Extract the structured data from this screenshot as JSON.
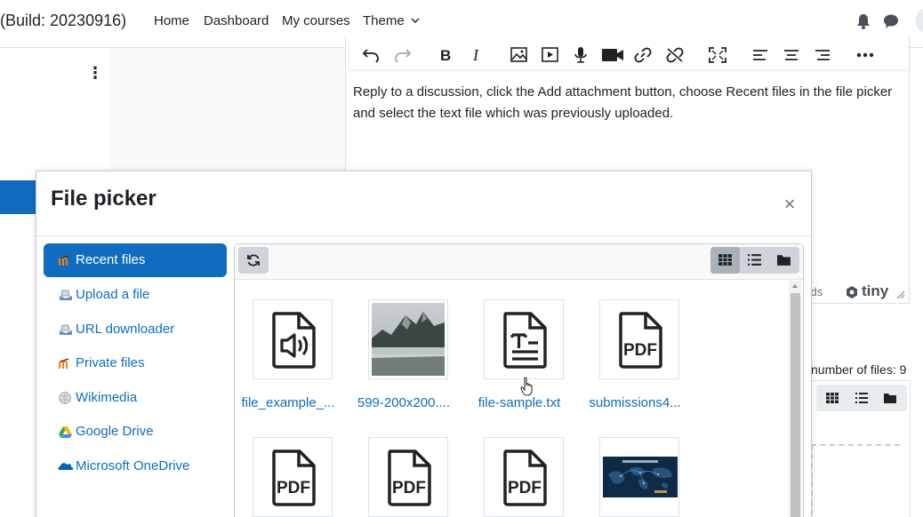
{
  "navbar": {
    "brand": "(Build: 20230916)",
    "links": [
      "Home",
      "Dashboard",
      "My courses",
      "Theme"
    ],
    "theme_dropdown_icon": "chevron-down-icon",
    "icons": [
      "bell-icon",
      "chat-icon"
    ]
  },
  "editor": {
    "toolbar_icons": [
      "undo-icon",
      "redo-icon",
      "bold-icon",
      "italic-icon",
      "image-icon",
      "media-icon",
      "record-audio-icon",
      "record-video-icon",
      "link-icon",
      "unlink-icon",
      "fullscreen-icon",
      "align-left-icon",
      "align-center-icon",
      "align-right-icon",
      "more-icon"
    ],
    "body_text": "Reply to a discussion, click the Add attachment button, choose Recent files in the file picker and select the text file which was previously uploaded.",
    "status_words": "ords",
    "status_brand": "tiny"
  },
  "filemanager": {
    "file_count_text": "number of files: 9"
  },
  "file_picker": {
    "title": "File picker",
    "close_symbol": "×",
    "repositories": [
      {
        "label": "Recent files",
        "icon": "moodle-icon",
        "active": true
      },
      {
        "label": "Upload a file",
        "icon": "upload-icon",
        "active": false
      },
      {
        "label": "URL downloader",
        "icon": "url-downloader-icon",
        "active": false
      },
      {
        "label": "Private files",
        "icon": "moodle-icon",
        "active": false
      },
      {
        "label": "Wikimedia",
        "icon": "wikimedia-icon",
        "active": false
      },
      {
        "label": "Google Drive",
        "icon": "google-drive-icon",
        "active": false
      },
      {
        "label": "Microsoft OneDrive",
        "icon": "onedrive-icon",
        "active": false
      }
    ],
    "toolbar": {
      "refresh_icon": "refresh-icon",
      "views": [
        "grid-view-icon",
        "list-view-icon",
        "tree-view-icon"
      ],
      "selected_view": "grid-view-icon"
    },
    "files": [
      {
        "name": "file_example_...",
        "type": "audio"
      },
      {
        "name": "599-200x200....",
        "type": "image"
      },
      {
        "name": "file-sample.txt",
        "type": "text"
      },
      {
        "name": "submissions4...",
        "type": "pdf"
      },
      {
        "name": "",
        "type": "pdf"
      },
      {
        "name": "",
        "type": "pdf"
      },
      {
        "name": "",
        "type": "pdf"
      },
      {
        "name": "",
        "type": "image"
      }
    ],
    "pdf_label": "PDF"
  },
  "colors": {
    "accent": "#0f6cbf",
    "text": "#1d2125",
    "muted": "#6a737b"
  }
}
